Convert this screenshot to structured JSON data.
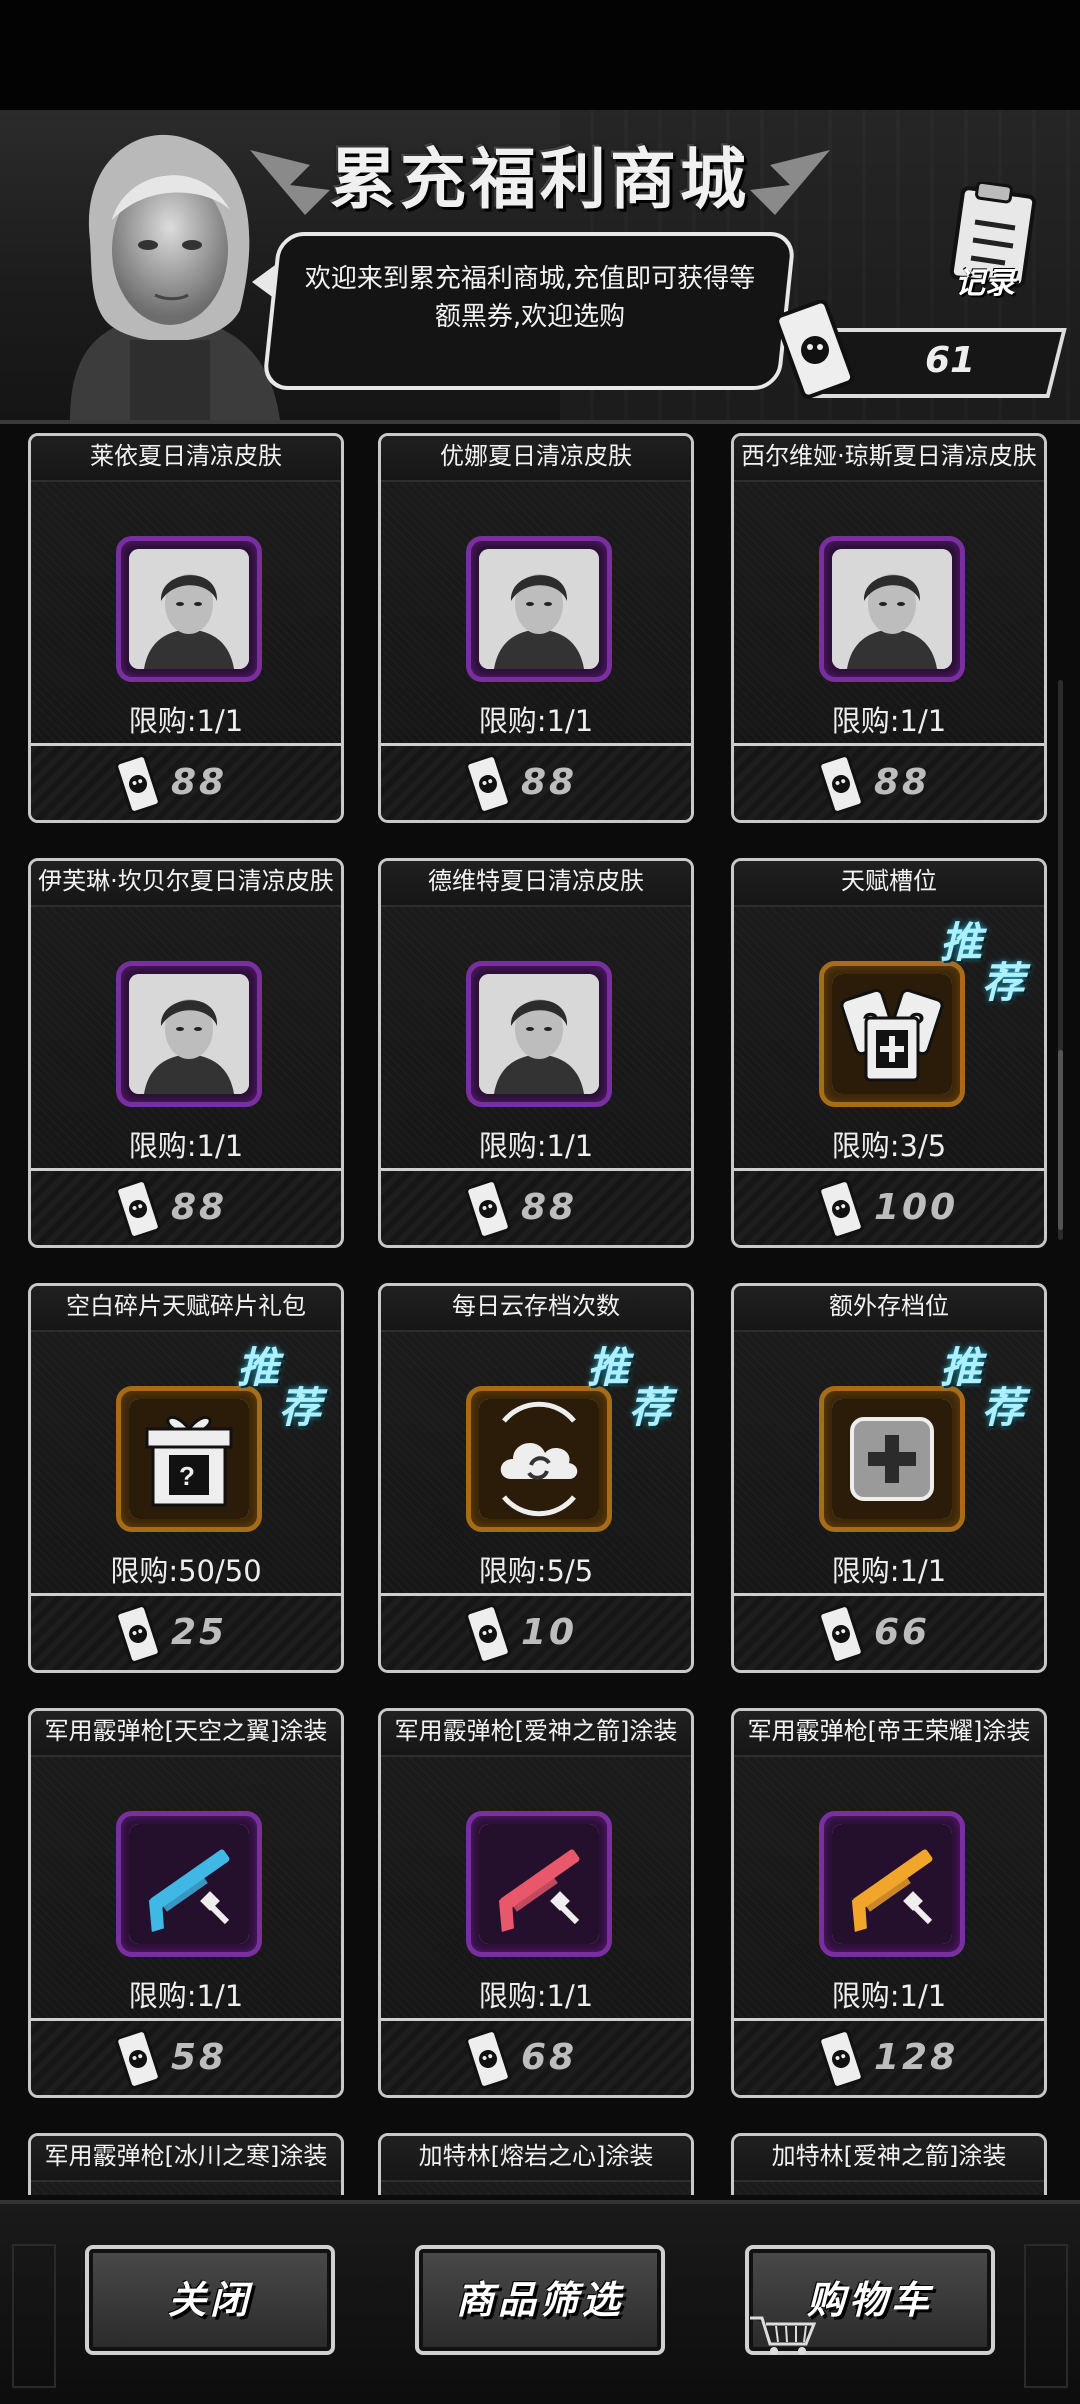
{
  "header": {
    "title": "累充福利商城",
    "speech": "欢迎来到累充福利商城,充值即可获得等额黑券,欢迎选购",
    "record_label": "记录",
    "balance": "61"
  },
  "items": [
    {
      "name": "莱依夏日清凉皮肤",
      "limit": "限购:1/1",
      "price": "88",
      "frame": "purple",
      "icon": "character-portrait-icon",
      "recommend": false
    },
    {
      "name": "优娜夏日清凉皮肤",
      "limit": "限购:1/1",
      "price": "88",
      "frame": "purple",
      "icon": "character-portrait-icon",
      "recommend": false
    },
    {
      "name": "西尔维娅·琼斯夏日清凉皮肤",
      "limit": "限购:1/1",
      "price": "88",
      "frame": "purple",
      "icon": "character-portrait-icon",
      "recommend": false
    },
    {
      "name": "伊芙琳·坎贝尔夏日清凉皮肤",
      "limit": "限购:1/1",
      "price": "88",
      "frame": "purple",
      "icon": "character-portrait-icon",
      "recommend": false
    },
    {
      "name": "德维特夏日清凉皮肤",
      "limit": "限购:1/1",
      "price": "88",
      "frame": "purple",
      "icon": "character-portrait-icon",
      "recommend": false
    },
    {
      "name": "天赋槽位",
      "limit": "限购:3/5",
      "price": "100",
      "frame": "orange",
      "icon": "talent-slot-icon",
      "recommend": true
    },
    {
      "name": "空白碎片天赋碎片礼包",
      "limit": "限购:50/50",
      "price": "25",
      "frame": "orange",
      "icon": "gift-box-icon",
      "recommend": true
    },
    {
      "name": "每日云存档次数",
      "limit": "限购:5/5",
      "price": "10",
      "frame": "orange",
      "icon": "cloud-sync-icon",
      "recommend": true
    },
    {
      "name": "额外存档位",
      "limit": "限购:1/1",
      "price": "66",
      "frame": "orange",
      "icon": "plus-slot-icon",
      "recommend": true
    },
    {
      "name": "军用霰弹枪[天空之翼]涂装",
      "limit": "限购:1/1",
      "price": "58",
      "frame": "purple",
      "icon": "shotgun-skin-icon",
      "gun_color": "#3fb8e6",
      "recommend": false
    },
    {
      "name": "军用霰弹枪[爱神之箭]涂装",
      "limit": "限购:1/1",
      "price": "68",
      "frame": "purple",
      "icon": "shotgun-skin-icon",
      "gun_color": "#e8586a",
      "recommend": false
    },
    {
      "name": "军用霰弹枪[帝王荣耀]涂装",
      "limit": "限购:1/1",
      "price": "128",
      "frame": "purple",
      "icon": "shotgun-skin-icon",
      "gun_color": "#f2a52b",
      "recommend": false
    },
    {
      "name": "军用霰弹枪[冰川之寒]涂装",
      "limit": "",
      "price": "",
      "frame": "purple",
      "icon": "",
      "recommend": false
    },
    {
      "name": "加特林[熔岩之心]涂装",
      "limit": "",
      "price": "",
      "frame": "purple",
      "icon": "",
      "recommend": false
    },
    {
      "name": "加特林[爱神之箭]涂装",
      "limit": "",
      "price": "",
      "frame": "purple",
      "icon": "",
      "recommend": false
    }
  ],
  "recommend_label": {
    "r1": "推",
    "r2": "荐"
  },
  "footer": {
    "close_label": "关闭",
    "filter_label": "商品筛选",
    "cart_label": "购物车"
  },
  "colors": {
    "purple_frame": "#7a2fa0",
    "orange_frame": "#a86b18",
    "recommend_text": "#aef0ff"
  }
}
